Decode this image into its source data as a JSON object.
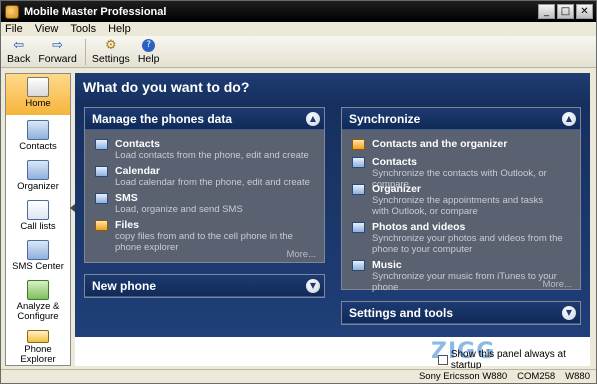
{
  "window": {
    "title": "Mobile Master Professional",
    "min": "_",
    "max": "□",
    "close": "✕"
  },
  "menu": [
    "File",
    "View",
    "Tools",
    "Help"
  ],
  "toolbar": {
    "back": "Back",
    "forward": "Forward",
    "settings": "Settings",
    "help": "Help"
  },
  "sidebar": [
    {
      "label": "Home",
      "icon": "home-icon"
    },
    {
      "label": "Contacts",
      "icon": "contacts-icon"
    },
    {
      "label": "Organizer",
      "icon": "organizer-icon"
    },
    {
      "label": "Call lists",
      "icon": "call-lists-icon"
    },
    {
      "label": "SMS Center",
      "icon": "sms-icon"
    },
    {
      "label": "Analyze & Configure",
      "icon": "analyze-icon"
    },
    {
      "label": "Phone Explorer",
      "icon": "phone-explorer-icon"
    }
  ],
  "main": {
    "title": "What do you want to do?",
    "manage": {
      "header": "Manage the phones data",
      "items": [
        {
          "title": "Contacts",
          "desc": "Load contacts from the phone, edit and create"
        },
        {
          "title": "Calendar",
          "desc": "Load calendar from the phone, edit and create"
        },
        {
          "title": "SMS",
          "desc": "Load, organize and send SMS"
        },
        {
          "title": "Files",
          "desc": "copy files from and to the cell phone in the phone explorer"
        }
      ],
      "more": "More..."
    },
    "new_phone": {
      "header": "New phone"
    },
    "sync": {
      "header": "Synchronize",
      "items": [
        {
          "title": "Contacts and the organizer",
          "desc": ""
        },
        {
          "title": "Contacts",
          "desc": "Synchronize the contacts with Outlook, or compare"
        },
        {
          "title": "Organizer",
          "desc": "Synchronize the appointments and tasks with Outlook, or compare"
        },
        {
          "title": "Photos and videos",
          "desc": "Synchronize your photos and videos from the phone to your computer"
        },
        {
          "title": "Music",
          "desc": "Synchronize your music from iTunes to your phone"
        }
      ],
      "more": "More..."
    },
    "settings": {
      "header": "Settings and tools"
    },
    "show_panel": "Show this panel always at startup"
  },
  "status": {
    "phone": "Sony Ericsson W880",
    "port": "COM258",
    "model": "W880"
  },
  "watermark": "ZIGG"
}
